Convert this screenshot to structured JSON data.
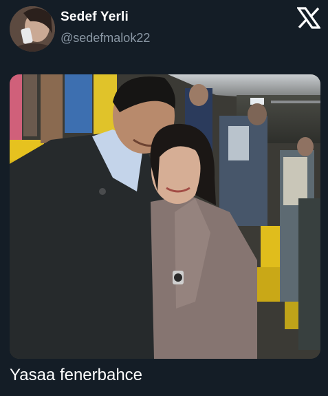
{
  "tweet": {
    "author": {
      "display_name": "Sedef Yerli",
      "handle": "@sedefmalok22"
    },
    "text": "Yasaa fenerbahce",
    "media": {
      "type": "photo",
      "subject": "couple-at-stadium"
    },
    "brand_icon": "x-logo-icon"
  },
  "colors": {
    "background": "#141d26",
    "primary_text": "#ffffff",
    "secondary_text": "#8b98a5"
  }
}
